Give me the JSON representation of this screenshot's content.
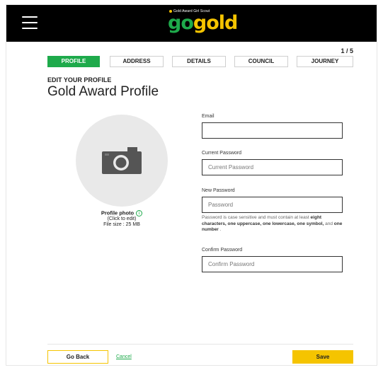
{
  "header": {
    "logo_small_text": "Gold Award Girl Scout",
    "logo_go": "go",
    "logo_gold": "gold"
  },
  "progress": {
    "step_text": "1 / 5"
  },
  "tabs": [
    {
      "label": "PROFILE",
      "active": true
    },
    {
      "label": "ADDRESS",
      "active": false
    },
    {
      "label": "DETAILS",
      "active": false
    },
    {
      "label": "COUNCIL",
      "active": false
    },
    {
      "label": "JOURNEY",
      "active": false
    }
  ],
  "page": {
    "kicker": "EDIT YOUR PROFILE",
    "title": "Gold Award Profile"
  },
  "photo": {
    "label": "Profile photo",
    "hint": "(Click to edit)",
    "size": "File size : 25 MB"
  },
  "form": {
    "email": {
      "label": "Email",
      "value": "",
      "placeholder": ""
    },
    "current_password": {
      "label": "Current Password",
      "placeholder": "Current Password"
    },
    "new_password": {
      "label": "New Password",
      "placeholder": "Password"
    },
    "help": {
      "t1": "Password is case sensitive and must contain at least ",
      "b1": "eight characters, one uppercase, one lowercase, one symbol,",
      "t2": " and ",
      "b2": "one number",
      "t3": " ."
    },
    "confirm_password": {
      "label": "Confirm Password",
      "placeholder": "Confirm Password"
    }
  },
  "footer": {
    "back_label": "Go Back",
    "cancel_label": "Cancel",
    "save_label": "Save"
  },
  "colors": {
    "brand_green": "#1eaa4b",
    "brand_gold": "#f5c400",
    "topbar": "#000000"
  }
}
